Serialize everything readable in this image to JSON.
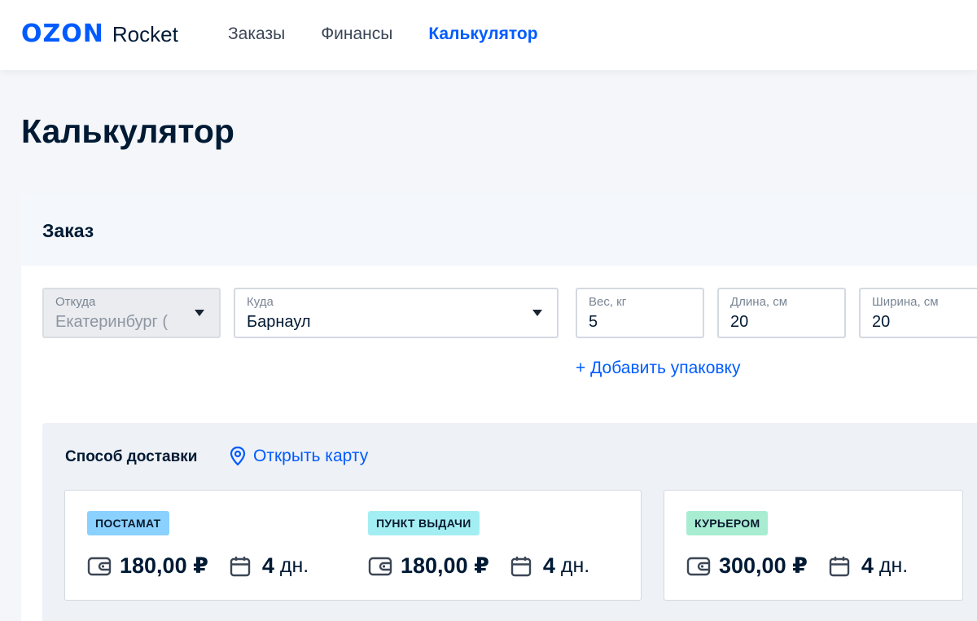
{
  "header": {
    "logo_brand": "OZON",
    "logo_product": "Rocket",
    "nav": [
      {
        "label": "Заказы"
      },
      {
        "label": "Финансы"
      },
      {
        "label": "Калькулятор"
      }
    ],
    "active_nav": "Калькулятор"
  },
  "page": {
    "title": "Калькулятор"
  },
  "order": {
    "title": "Заказ",
    "fields": {
      "from": {
        "label": "Откуда",
        "value": "Екатеринбург ("
      },
      "to": {
        "label": "Куда",
        "value": "Барнаул"
      },
      "weight": {
        "label": "Вес, кг",
        "value": "5"
      },
      "length": {
        "label": "Длина, см",
        "value": "20"
      },
      "width": {
        "label": "Ширина, см",
        "value": "20"
      }
    },
    "add_package": "+ Добавить упаковку"
  },
  "delivery": {
    "title": "Способ доставки",
    "open_map": "Открыть карту",
    "options": [
      {
        "badge": "ПОСТАМАТ",
        "price": "180,00 ₽",
        "days": "4",
        "days_unit": "дн."
      },
      {
        "badge": "ПУНКТ ВЫДАЧИ",
        "price": "180,00 ₽",
        "days": "4",
        "days_unit": "дн."
      },
      {
        "badge": "КУРЬЕРОМ",
        "price": "300,00 ₽",
        "days": "4",
        "days_unit": "дн."
      }
    ]
  },
  "colors": {
    "accent": "#005bff",
    "badge_postamat": "#8ad1ff",
    "badge_pickup": "#a3eef3",
    "badge_courier": "#a8ecd2"
  },
  "icons": [
    "wallet-icon",
    "calendar-icon",
    "map-pin-icon",
    "chevron-down-icon"
  ]
}
